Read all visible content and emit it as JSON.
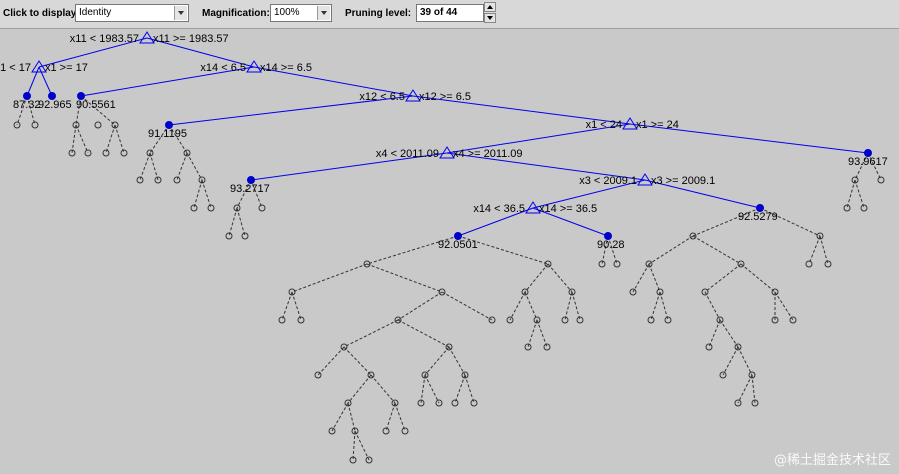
{
  "toolbar": {
    "display_label": "Click to display:",
    "display_value": "Identity",
    "magnification_label": "Magnification:",
    "magnification_value": "100%",
    "pruning_label": "Pruning level:",
    "pruning_value": "39 of 44"
  },
  "tree": {
    "split_labels": [
      {
        "left": "x11 < 1983.57",
        "right": "x11 >= 1983.57"
      },
      {
        "left": "1 < 17",
        "right": "x1 >= 17"
      },
      {
        "left": "x14 < 6.5",
        "right": "x14 >= 6.5"
      },
      {
        "left": "x12 < 6.5",
        "right": "x12 >= 6.5"
      },
      {
        "left": "x1 < 24",
        "right": "x1 >= 24"
      },
      {
        "left": "x4 < 2011.09",
        "right": "x4 >= 2011.09"
      },
      {
        "left": "x3 < 2009.1",
        "right": "x3 >= 2009.1"
      },
      {
        "left": "x14 < 36.5",
        "right": "x14 >= 36.5"
      }
    ],
    "leaf_labels": [
      "87.32",
      "92.965",
      "90.5561",
      "91.1195",
      "93.9617",
      "93.2717",
      "92.5279",
      "92.0501",
      "90.28"
    ]
  },
  "watermark": "@稀土掘金技术社区"
}
